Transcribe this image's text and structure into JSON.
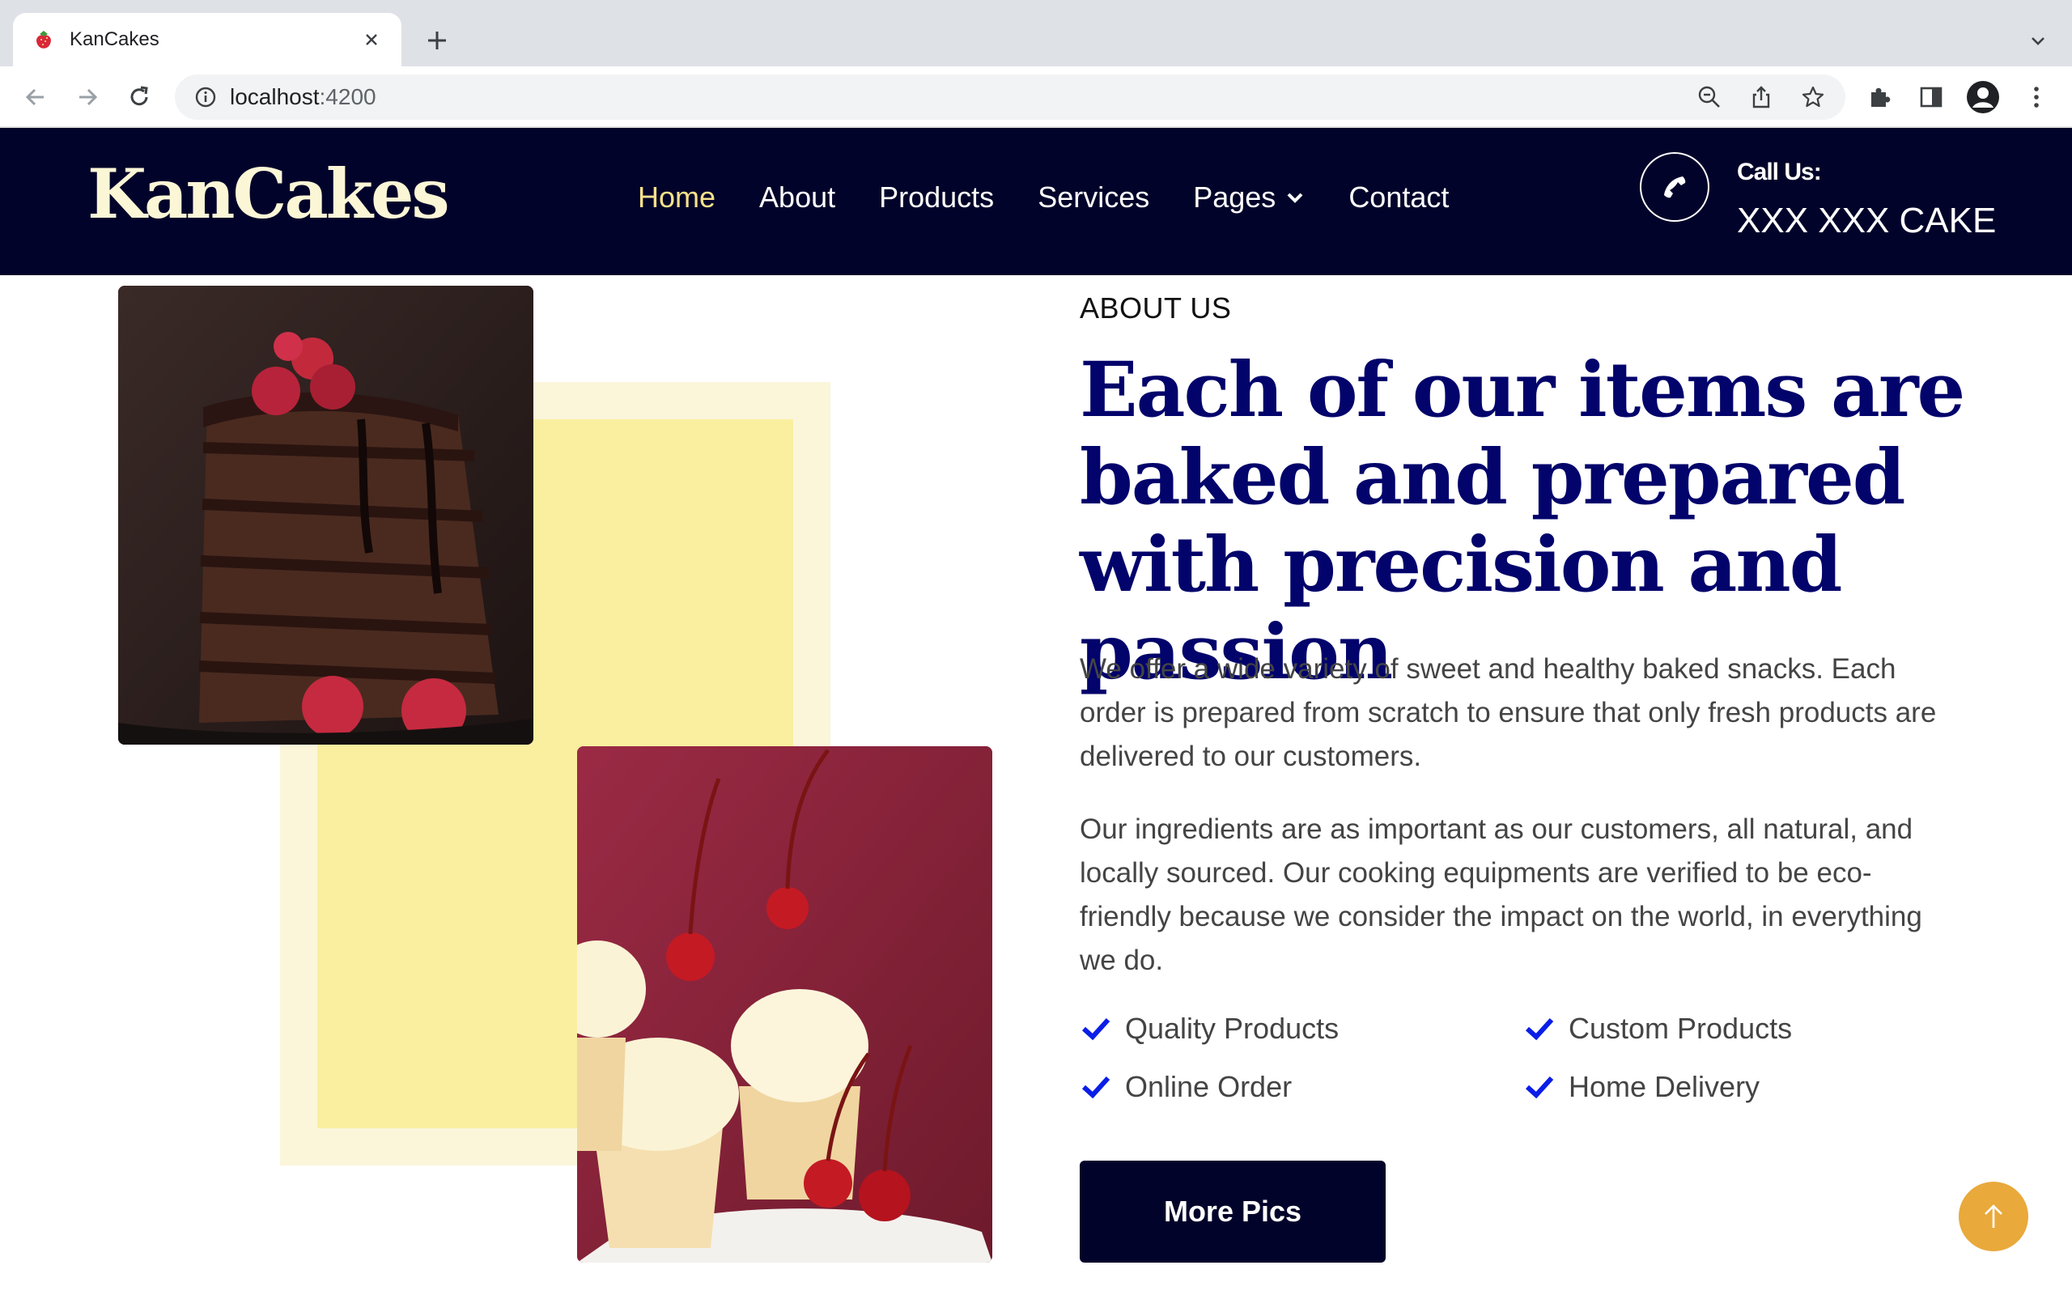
{
  "browser": {
    "tab_title": "KanCakes",
    "url_host": "localhost",
    "url_port": ":4200"
  },
  "site": {
    "logo": "KanCakes",
    "nav": [
      {
        "label": "Home",
        "active": true
      },
      {
        "label": "About"
      },
      {
        "label": "Products"
      },
      {
        "label": "Services"
      },
      {
        "label": "Pages"
      },
      {
        "label": "Contact"
      }
    ],
    "call_label": "Call Us:",
    "call_number": "XXX XXX CAKE"
  },
  "about": {
    "eyebrow": "ABOUT US",
    "heading": "Each of our items are baked and prepared with precision and passion",
    "para1": "We offer a wide variety of sweet and healthy baked snacks. Each order is prepared from scratch to ensure that only fresh products are delivered to our customers.",
    "para2": "Our ingredients are as important as our customers, all natural, and locally sourced. Our cooking equipments are verified to be eco-friendly because we consider the impact on the world, in everything we do.",
    "features": [
      "Quality Products",
      "Custom Products",
      "Online Order",
      "Home Delivery"
    ],
    "button": "More Pics"
  },
  "colors": {
    "header_bg": "#02032a",
    "accent_yellow": "#f7e28b",
    "heading_navy": "#02036b",
    "check_blue": "#0a1ee8",
    "scroll_top_gold": "#e9a93b"
  }
}
